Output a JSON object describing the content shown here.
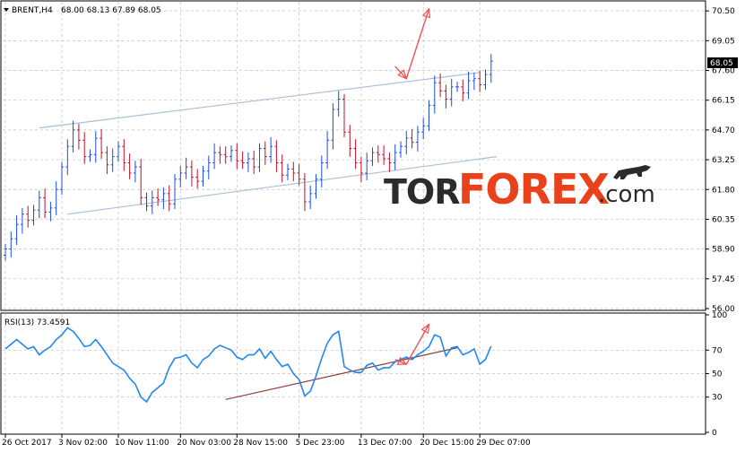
{
  "chart_data": [
    {
      "type": "candlestick",
      "header": {
        "symbol": "BRENT,H4",
        "ohlc": "68.00 68.13 67.89 68.05"
      },
      "ylim": [
        56.0,
        70.9
      ],
      "y_ticks": [
        "70.50",
        "69.05",
        "67.60",
        "66.15",
        "64.70",
        "63.25",
        "61.80",
        "60.35",
        "58.90",
        "57.45",
        "56.00"
      ],
      "last_price": "68.05",
      "x_ticks": [
        "26 Oct 2017",
        "3 Nov 02:00",
        "10 Nov 11:00",
        "20 Nov 03:00",
        "28 Nov 15:00",
        "5 Dec 23:00",
        "13 Dec 07:00",
        "20 Dec 15:00",
        "29 Dec 07:00"
      ],
      "series": [
        {
          "close": [
            58.9,
            59.4,
            60.1,
            60.6,
            60.3,
            60.8,
            61.4,
            60.7,
            60.9,
            61.8,
            62.9,
            63.9,
            64.7,
            64.2,
            63.4,
            63.5,
            64.3,
            63.6,
            63.0,
            63.4,
            63.9,
            63.1,
            62.6,
            62.9,
            61.4,
            61.0,
            61.4,
            61.3,
            61.6,
            61.1,
            62.3,
            62.6,
            62.9,
            62.4,
            62.2,
            62.7,
            63.1,
            63.6,
            63.5,
            63.4,
            63.7,
            63.2,
            63.1,
            63.3,
            62.9,
            63.8,
            63.4,
            63.9,
            63.1,
            62.5,
            62.8,
            62.6,
            62.3,
            61.2,
            61.6,
            62.3,
            63.1,
            64.2,
            65.7,
            66.2,
            64.6,
            63.8,
            63.1,
            62.6,
            63.2,
            63.6,
            63.5,
            63.3,
            63.1,
            63.6,
            63.9,
            64.3,
            64.1,
            64.6,
            64.9,
            65.9,
            67.0,
            66.6,
            66.2,
            66.8,
            66.8,
            66.5,
            67.1,
            67.2,
            66.9,
            67.4,
            68.05
          ]
        }
      ],
      "trend_lines": [
        {
          "from": [
            6,
            64.8
          ],
          "to": [
            84,
            67.5
          ]
        },
        {
          "from": [
            11,
            60.6
          ],
          "to": [
            87,
            63.4
          ]
        }
      ],
      "arrows": [
        {
          "from": [
            69,
            67.8
          ],
          "to": [
            71,
            67.2
          ]
        },
        {
          "from": [
            71,
            67.2
          ],
          "to": [
            75,
            70.6
          ]
        }
      ]
    },
    {
      "type": "line",
      "title": "RSI(13) 73.4591",
      "ylim": [
        0,
        100
      ],
      "y_ticks": [
        "100",
        "70",
        "50",
        "30",
        "0"
      ],
      "series": [
        {
          "name": "RSI(13)",
          "values": [
            71,
            75,
            79,
            75,
            71,
            73,
            66,
            70,
            73,
            79,
            83,
            89,
            86,
            80,
            73,
            74,
            79,
            73,
            66,
            59,
            56,
            53,
            46,
            41,
            30,
            26,
            34,
            38,
            42,
            55,
            63,
            64,
            66,
            59,
            55,
            62,
            65,
            71,
            74,
            72,
            70,
            64,
            62,
            66,
            66,
            71,
            63,
            69,
            62,
            56,
            58,
            50,
            45,
            31,
            35,
            48,
            63,
            76,
            83,
            86,
            56,
            53,
            51,
            51,
            57,
            59,
            53,
            55,
            55,
            60,
            62,
            64,
            62,
            66,
            69,
            73,
            83,
            81,
            65,
            72,
            73,
            66,
            68,
            71,
            58,
            62,
            73.46
          ]
        }
      ],
      "trend_line": {
        "from": [
          39,
          28
        ],
        "to": [
          80,
          72
        ]
      },
      "arrows": [
        {
          "from": [
            69,
            62
          ],
          "to": [
            71,
            58
          ]
        },
        {
          "from": [
            71,
            58
          ],
          "to": [
            75,
            92
          ]
        }
      ]
    }
  ],
  "watermark": {
    "part1": "TOR",
    "part2": "FOREX",
    "part3": ".com"
  },
  "colors": {
    "bull": "#1a4de6",
    "bear": "#c0102a",
    "rsi": "#2288ee",
    "channel": "#a9bfd8",
    "rsi_trend": "#8b3a3a",
    "arrow": "#f0524f",
    "grid": "#c0c0c0"
  }
}
